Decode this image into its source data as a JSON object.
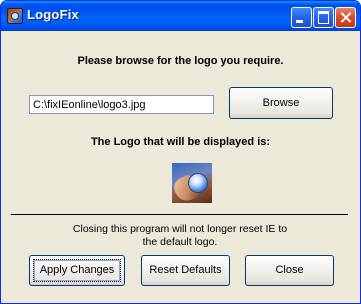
{
  "window": {
    "title": "LogoFix",
    "icon": "logofix-app-icon",
    "controls": {
      "minimize_icon": "minimize-icon",
      "maximize_icon": "maximize-icon",
      "close_icon": "close-icon"
    }
  },
  "main": {
    "instruction": "Please browse for the logo you require.",
    "path_value": "C:\\fixIEonline\\logo3.jpg",
    "browse_label": "Browse",
    "logo_caption": "The Logo that will be displayed is:",
    "logo_preview": "logo-preview-image",
    "notice_line1": "Closing this program will not longer reset IE to",
    "notice_line2": "the default logo."
  },
  "buttons": {
    "apply_label": "Apply Changes",
    "reset_label": "Reset Defaults",
    "close_label": "Close"
  },
  "colors": {
    "titlebar": "#0054e3",
    "window_face": "#ece9d8",
    "button_border": "#003c74",
    "close_button": "#d9502a"
  }
}
